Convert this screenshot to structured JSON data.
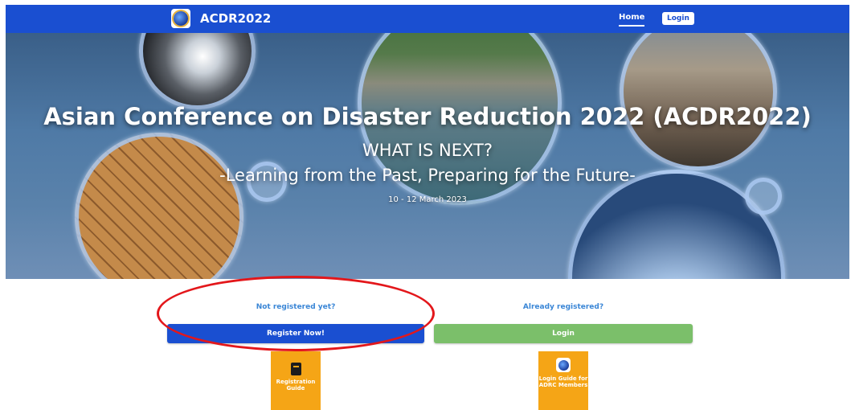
{
  "navbar": {
    "brand": "ACDR2022",
    "logo_icon": "adrc-globe-logo",
    "home": "Home",
    "login": "Login",
    "color": "#1a4fd1"
  },
  "hero": {
    "title": "Asian Conference on Disaster Reduction 2022 (ACDR2022)",
    "subtitle_line1": "WHAT IS NEXT?",
    "subtitle_line2": "-Learning from the Past, Preparing for the Future-",
    "date": "10 - 12 March 2023"
  },
  "registration": {
    "not_registered_text": "Not registered yet?",
    "register_button": "Register Now!",
    "register_color": "#1a4fd1",
    "already_registered_text": "Already registered?",
    "login_button": "Login",
    "login_color": "#7bbf6a"
  },
  "guides": {
    "registration_guide": {
      "label": "Registration Guide",
      "icon": "book-icon"
    },
    "login_guide": {
      "label": "Login Guide for ADRC Members",
      "icon": "adrc-globe-logo"
    },
    "color": "#f5a516"
  },
  "annotation": {
    "color": "#e3171b"
  }
}
